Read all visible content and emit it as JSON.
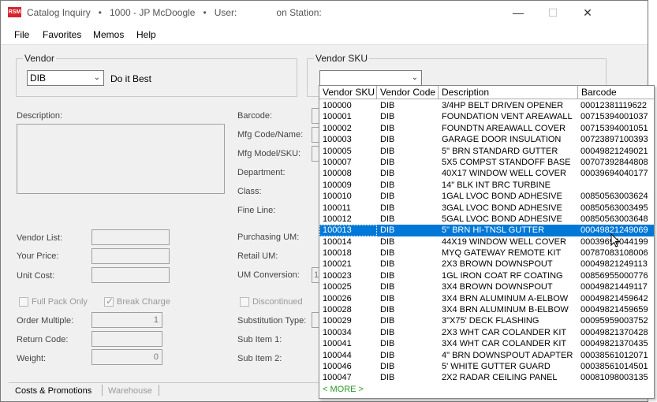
{
  "titlebar": {
    "app_icon": "RSM",
    "title_prefix": "Catalog Inquiry",
    "separator": "•",
    "store": "1000 - JP McDoogle",
    "user_label": "User:",
    "station_label": "on Station:",
    "minimize_icon": "—",
    "maximize_icon": "☐",
    "close_icon": "✕"
  },
  "menu": [
    "File",
    "Favorites",
    "Memos",
    "Help"
  ],
  "vendor": {
    "group_title": "Vendor",
    "code": "DIB",
    "name": "Do it Best"
  },
  "vendor_sku": {
    "group_title": "Vendor SKU",
    "value": ""
  },
  "left_fields": {
    "description_label": "Description:",
    "vendor_list": "Vendor List:",
    "your_price": "Your Price:",
    "unit_cost": "Unit Cost:",
    "full_pack_only": "Full Pack Only",
    "break_charge": "Break Charge",
    "order_multiple": "Order Multiple:",
    "order_multiple_value": "1",
    "return_code": "Return Code:",
    "weight": "Weight:",
    "weight_value": "0"
  },
  "mid_fields": {
    "barcode": "Barcode:",
    "mfg_code_name": "Mfg Code/Name:",
    "mfg_model_sku": "Mfg Model/SKU:",
    "department": "Department:",
    "class": "Class:",
    "fine_line": "Fine Line:",
    "purchasing_um": "Purchasing UM:",
    "retail_um": "Retail UM:",
    "um_conversion": "UM Conversion:",
    "um_conversion_value": "1",
    "discontinued": "Discontinued",
    "substitution_type": "Substitution Type:",
    "sub_item_1": "Sub Item 1:",
    "sub_item_2": "Sub Item 2:"
  },
  "bottom_tabs": [
    "Costs & Promotions",
    "Warehouse"
  ],
  "dropdown": {
    "columns": [
      "Vendor SKU",
      "Vendor Code",
      "Description",
      "Barcode"
    ],
    "rows": [
      [
        "100000",
        "DIB",
        "3/4HP BELT DRIVEN OPENER",
        "00012381119622"
      ],
      [
        "100001",
        "DIB",
        "FOUNDATION VENT AREAWALL",
        "00715394001037"
      ],
      [
        "100002",
        "DIB",
        "FOUNDTN AREAWALL COVER",
        "00715394001051"
      ],
      [
        "100003",
        "DIB",
        "GARAGE DOOR INSULATION",
        "00723897100393"
      ],
      [
        "100005",
        "DIB",
        "5\" BRN STANDARD GUTTER",
        "00049821249021"
      ],
      [
        "100007",
        "DIB",
        "5X5 COMPST STANDOFF BASE",
        "00707392844808"
      ],
      [
        "100008",
        "DIB",
        "40X17 WINDOW WELL COVER",
        "00039694040177"
      ],
      [
        "100009",
        "DIB",
        "14\" BLK INT BRC TURBINE",
        ""
      ],
      [
        "100010",
        "DIB",
        "1GAL LVOC BOND ADHESIVE",
        "00850563003624"
      ],
      [
        "100011",
        "DIB",
        "3GAL LVOC BOND ADHESIVE",
        "00850563003495"
      ],
      [
        "100012",
        "DIB",
        "5GAL LVOC BOND ADHESIVE",
        "00850563003648"
      ],
      [
        "100013",
        "DIB",
        "5\" BRN HI-TNSL GUTTER",
        "00049821249069"
      ],
      [
        "100014",
        "DIB",
        "44X19 WINDOW WELL COVER",
        "00039694044199"
      ],
      [
        "100018",
        "DIB",
        "MYQ GATEWAY REMOTE KIT",
        "00787083108006"
      ],
      [
        "100021",
        "DIB",
        "2X3 BROWN DOWNSPOUT",
        "00049821249113"
      ],
      [
        "100023",
        "DIB",
        "1GL IRON COAT RF COATING",
        "00856955000776"
      ],
      [
        "100025",
        "DIB",
        "3X4 BROWN DOWNSPOUT",
        "00049821449117"
      ],
      [
        "100026",
        "DIB",
        "3X4 BRN ALUMINUM A-ELBOW",
        "00049821459642"
      ],
      [
        "100028",
        "DIB",
        "3X4 BRN ALUMINUM B-ELBOW",
        "00049821459659"
      ],
      [
        "100029",
        "DIB",
        "3\"X75' DECK FLASHING",
        "00095959003752"
      ],
      [
        "100034",
        "DIB",
        "2X3 WHT CAR COLANDER KIT",
        "00049821370428"
      ],
      [
        "100041",
        "DIB",
        "3X4 WHT CAR COLANDER KIT",
        "00049821370435"
      ],
      [
        "100044",
        "DIB",
        "4\" BRN DOWNSPOUT ADAPTER",
        "00038561012071"
      ],
      [
        "100046",
        "DIB",
        "5' WHITE GUTTER GUARD",
        "00038561014501"
      ],
      [
        "100047",
        "DIB",
        "2X2 RADAR CEILING PANEL",
        "00081098003135"
      ]
    ],
    "selected_index": 11,
    "more_label": "< MORE >"
  },
  "colors": {
    "selection": "#0078d7",
    "more_link": "#2a9a2a",
    "app_icon": "#d8232a"
  }
}
